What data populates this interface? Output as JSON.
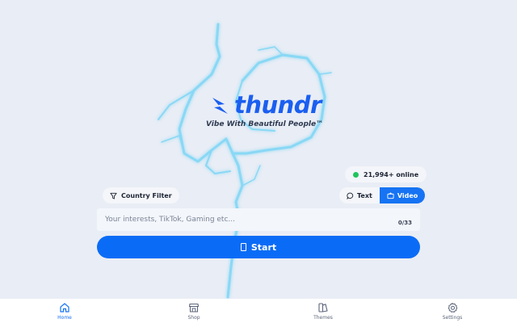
{
  "brand": {
    "name": "thundr",
    "tagline": "Vibe With Beautiful People™",
    "color": "#1a5ff0"
  },
  "online": {
    "text": "21,994+ online",
    "status_color": "#21c45d"
  },
  "filters": {
    "country_label": "Country Filter"
  },
  "modes": [
    {
      "label": "Text",
      "icon": "chat-bubble-icon",
      "active": false
    },
    {
      "label": "Video",
      "icon": "video-icon",
      "active": true
    }
  ],
  "interests": {
    "placeholder": "Your interests, TikTok, Gaming etc...",
    "value": "",
    "count": "0/33"
  },
  "start": {
    "label": "Start",
    "color": "#0a6cf6"
  },
  "nav": [
    {
      "label": "Home",
      "icon": "home-icon",
      "active": true
    },
    {
      "label": "Shop",
      "icon": "shop-icon",
      "active": false
    },
    {
      "label": "Themes",
      "icon": "themes-icon",
      "active": false
    },
    {
      "label": "Settings",
      "icon": "gear-icon",
      "active": false
    }
  ],
  "colors": {
    "accent": "#1673f3",
    "background": "#e9edf5",
    "lightning": "#7fd6f5"
  }
}
